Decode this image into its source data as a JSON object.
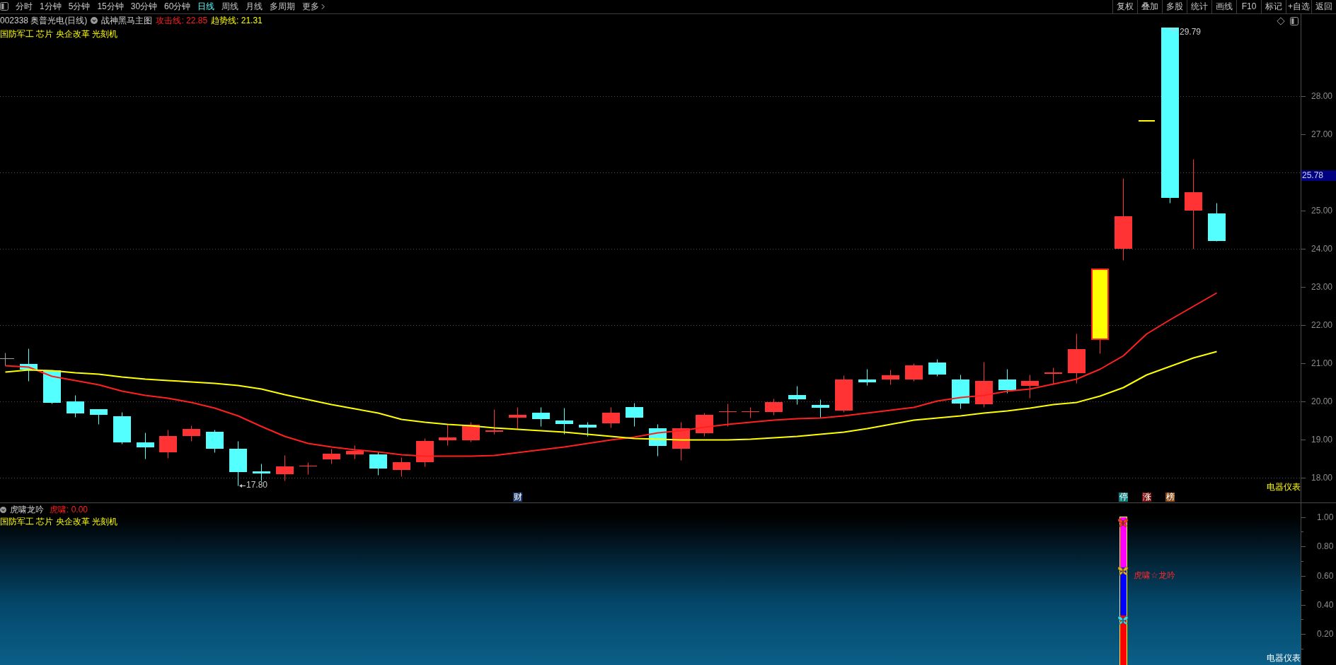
{
  "toolbar": {
    "periods": [
      {
        "label": "分时",
        "selected": false
      },
      {
        "label": "1分钟",
        "selected": false
      },
      {
        "label": "5分钟",
        "selected": false
      },
      {
        "label": "15分钟",
        "selected": false
      },
      {
        "label": "30分钟",
        "selected": false
      },
      {
        "label": "60分钟",
        "selected": false
      },
      {
        "label": "日线",
        "selected": true
      },
      {
        "label": "周线",
        "selected": false
      },
      {
        "label": "月线",
        "selected": false
      },
      {
        "label": "多周期",
        "selected": false
      }
    ],
    "more": "更多",
    "actions": [
      "复权",
      "叠加",
      "多股",
      "统计",
      "画线",
      "F10",
      "标记",
      "+自选",
      "返回"
    ]
  },
  "main_chart": {
    "title": "002338 奥普光电(日线)",
    "indicator": "战神黑马主图",
    "lines": [
      {
        "label": "攻击线: 22.85",
        "color": "#ff2020"
      },
      {
        "label": "趋势线: 21.31",
        "color": "#ffff00"
      }
    ],
    "tags": "国防军工 芯片 央企改革 光刻机",
    "price_axis": [
      "28.00",
      "27.00",
      "25.00",
      "24.00",
      "23.00",
      "22.00",
      "21.00",
      "20.00",
      "19.00",
      "18.00"
    ],
    "current_price": "25.78",
    "high_label": "29.79",
    "low_label": "17.80",
    "events": [
      {
        "label": "财",
        "color": "#1d3d6e"
      },
      {
        "label": "停",
        "color": "#0e7f7f"
      },
      {
        "label": "涨",
        "color": "#7d0f0f"
      },
      {
        "label": "榜",
        "color": "#8a4a12"
      }
    ],
    "sector": "电器仪表"
  },
  "indicator_panel": {
    "title": "虎啸龙吟",
    "value": "虎啸: 0.00",
    "tags": "国防军工 芯片 央企改革 光刻机",
    "signal": "虎啸☆龙吟",
    "value_axis": [
      "1.00",
      "0.80",
      "0.60",
      "0.40",
      "0.20"
    ],
    "sector": "电器仪表"
  }
}
